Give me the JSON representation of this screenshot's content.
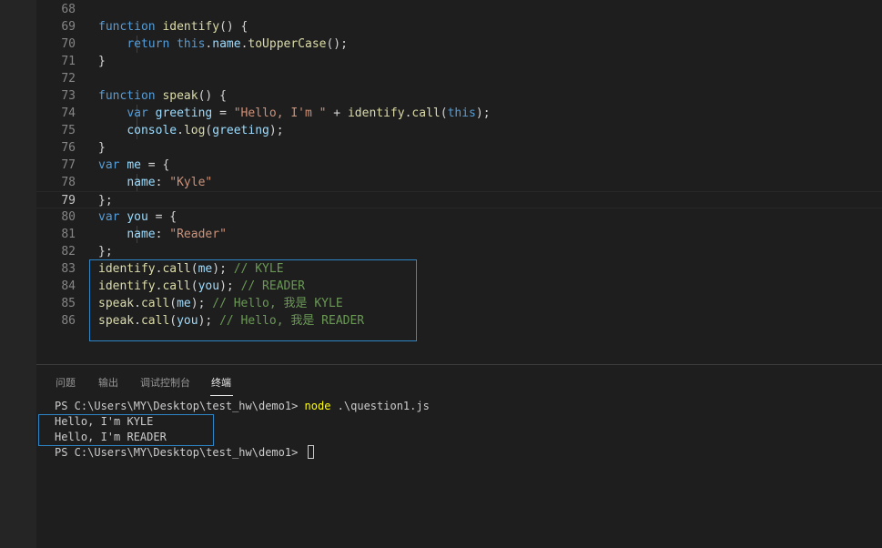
{
  "editor": {
    "active_line": "79",
    "lines": [
      {
        "num": "68",
        "tokens": []
      },
      {
        "num": "69",
        "tokens": [
          [
            "kw",
            "function"
          ],
          [
            "pn",
            " "
          ],
          [
            "fn",
            "identify"
          ],
          [
            "pn",
            "() {"
          ]
        ]
      },
      {
        "num": "70",
        "tokens": [
          [
            "pn",
            "    "
          ],
          [
            "kw",
            "return"
          ],
          [
            "pn",
            " "
          ],
          [
            "kw",
            "this"
          ],
          [
            "pn",
            "."
          ],
          [
            "var",
            "name"
          ],
          [
            "pn",
            "."
          ],
          [
            "fn",
            "toUpperCase"
          ],
          [
            "pn",
            "();"
          ]
        ]
      },
      {
        "num": "71",
        "tokens": [
          [
            "pn",
            "}"
          ]
        ]
      },
      {
        "num": "72",
        "tokens": []
      },
      {
        "num": "73",
        "tokens": [
          [
            "kw",
            "function"
          ],
          [
            "pn",
            " "
          ],
          [
            "fn",
            "speak"
          ],
          [
            "pn",
            "() {"
          ]
        ]
      },
      {
        "num": "74",
        "tokens": [
          [
            "pn",
            "    "
          ],
          [
            "kw",
            "var"
          ],
          [
            "pn",
            " "
          ],
          [
            "var",
            "greeting"
          ],
          [
            "pn",
            " = "
          ],
          [
            "str",
            "\"Hello, I'm \""
          ],
          [
            "pn",
            " + "
          ],
          [
            "fn",
            "identify"
          ],
          [
            "pn",
            "."
          ],
          [
            "fn",
            "call"
          ],
          [
            "pn",
            "("
          ],
          [
            "kw",
            "this"
          ],
          [
            "pn",
            ");"
          ]
        ]
      },
      {
        "num": "75",
        "tokens": [
          [
            "pn",
            "    "
          ],
          [
            "var",
            "console"
          ],
          [
            "pn",
            "."
          ],
          [
            "fn",
            "log"
          ],
          [
            "pn",
            "("
          ],
          [
            "var",
            "greeting"
          ],
          [
            "pn",
            ");"
          ]
        ]
      },
      {
        "num": "76",
        "tokens": [
          [
            "pn",
            "}"
          ]
        ]
      },
      {
        "num": "77",
        "tokens": [
          [
            "kw",
            "var"
          ],
          [
            "pn",
            " "
          ],
          [
            "var",
            "me"
          ],
          [
            "pn",
            " = {"
          ]
        ]
      },
      {
        "num": "78",
        "tokens": [
          [
            "pn",
            "    "
          ],
          [
            "var",
            "name"
          ],
          [
            "pn",
            ": "
          ],
          [
            "str",
            "\"Kyle\""
          ]
        ]
      },
      {
        "num": "79",
        "tokens": [
          [
            "pn",
            "};"
          ]
        ]
      },
      {
        "num": "80",
        "tokens": [
          [
            "kw",
            "var"
          ],
          [
            "pn",
            " "
          ],
          [
            "var",
            "you"
          ],
          [
            "pn",
            " = {"
          ]
        ]
      },
      {
        "num": "81",
        "tokens": [
          [
            "pn",
            "    "
          ],
          [
            "var",
            "name"
          ],
          [
            "pn",
            ": "
          ],
          [
            "str",
            "\"Reader\""
          ]
        ]
      },
      {
        "num": "82",
        "tokens": [
          [
            "pn",
            "};"
          ]
        ]
      },
      {
        "num": "83",
        "tokens": [
          [
            "fn",
            "identify"
          ],
          [
            "pn",
            "."
          ],
          [
            "fn",
            "call"
          ],
          [
            "pn",
            "("
          ],
          [
            "var",
            "me"
          ],
          [
            "pn",
            "); "
          ],
          [
            "cmt",
            "// KYLE"
          ]
        ]
      },
      {
        "num": "84",
        "tokens": [
          [
            "fn",
            "identify"
          ],
          [
            "pn",
            "."
          ],
          [
            "fn",
            "call"
          ],
          [
            "pn",
            "("
          ],
          [
            "var",
            "you"
          ],
          [
            "pn",
            "); "
          ],
          [
            "cmt",
            "// READER"
          ]
        ]
      },
      {
        "num": "85",
        "tokens": [
          [
            "fn",
            "speak"
          ],
          [
            "pn",
            "."
          ],
          [
            "fn",
            "call"
          ],
          [
            "pn",
            "("
          ],
          [
            "var",
            "me"
          ],
          [
            "pn",
            "); "
          ],
          [
            "cmt",
            "// Hello, 我是 KYLE"
          ]
        ]
      },
      {
        "num": "86",
        "tokens": [
          [
            "fn",
            "speak"
          ],
          [
            "pn",
            "."
          ],
          [
            "fn",
            "call"
          ],
          [
            "pn",
            "("
          ],
          [
            "var",
            "you"
          ],
          [
            "pn",
            "); "
          ],
          [
            "cmt",
            "// Hello, 我是 READER"
          ]
        ]
      }
    ]
  },
  "panel": {
    "tabs": [
      {
        "label": "问题",
        "active": false
      },
      {
        "label": "输出",
        "active": false
      },
      {
        "label": "调试控制台",
        "active": false
      },
      {
        "label": "终端",
        "active": true
      }
    ]
  },
  "terminal": {
    "prompt": "PS C:\\Users\\MY\\Desktop\\test_hw\\demo1> ",
    "command": "node",
    "args": " .\\question1.js",
    "output": [
      "Hello, I'm KYLE",
      "Hello, I'm READER"
    ]
  },
  "colors": {
    "background": "#1e1e1e",
    "keyword": "#569cd6",
    "function": "#dcdcaa",
    "variable": "#9cdcfe",
    "string": "#ce9178",
    "comment": "#6a9955",
    "highlight_box": "#2f86c7",
    "terminal_command": "#ffff00"
  }
}
